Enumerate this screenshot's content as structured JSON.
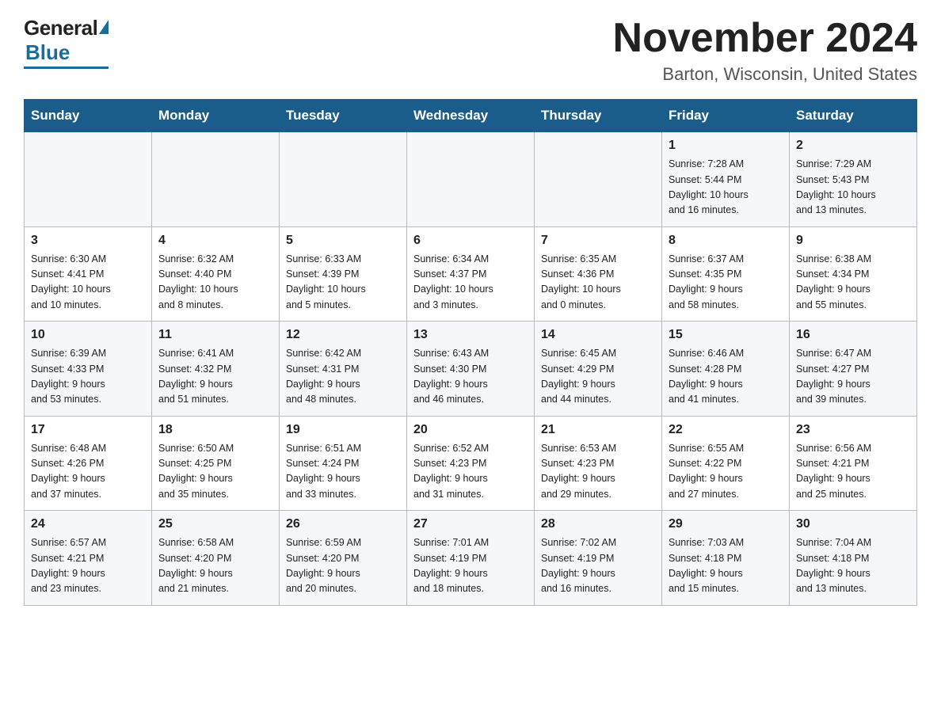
{
  "logo": {
    "general": "General",
    "blue": "Blue"
  },
  "title": "November 2024",
  "location": "Barton, Wisconsin, United States",
  "weekdays": [
    "Sunday",
    "Monday",
    "Tuesday",
    "Wednesday",
    "Thursday",
    "Friday",
    "Saturday"
  ],
  "weeks": [
    [
      {
        "day": "",
        "info": ""
      },
      {
        "day": "",
        "info": ""
      },
      {
        "day": "",
        "info": ""
      },
      {
        "day": "",
        "info": ""
      },
      {
        "day": "",
        "info": ""
      },
      {
        "day": "1",
        "info": "Sunrise: 7:28 AM\nSunset: 5:44 PM\nDaylight: 10 hours\nand 16 minutes."
      },
      {
        "day": "2",
        "info": "Sunrise: 7:29 AM\nSunset: 5:43 PM\nDaylight: 10 hours\nand 13 minutes."
      }
    ],
    [
      {
        "day": "3",
        "info": "Sunrise: 6:30 AM\nSunset: 4:41 PM\nDaylight: 10 hours\nand 10 minutes."
      },
      {
        "day": "4",
        "info": "Sunrise: 6:32 AM\nSunset: 4:40 PM\nDaylight: 10 hours\nand 8 minutes."
      },
      {
        "day": "5",
        "info": "Sunrise: 6:33 AM\nSunset: 4:39 PM\nDaylight: 10 hours\nand 5 minutes."
      },
      {
        "day": "6",
        "info": "Sunrise: 6:34 AM\nSunset: 4:37 PM\nDaylight: 10 hours\nand 3 minutes."
      },
      {
        "day": "7",
        "info": "Sunrise: 6:35 AM\nSunset: 4:36 PM\nDaylight: 10 hours\nand 0 minutes."
      },
      {
        "day": "8",
        "info": "Sunrise: 6:37 AM\nSunset: 4:35 PM\nDaylight: 9 hours\nand 58 minutes."
      },
      {
        "day": "9",
        "info": "Sunrise: 6:38 AM\nSunset: 4:34 PM\nDaylight: 9 hours\nand 55 minutes."
      }
    ],
    [
      {
        "day": "10",
        "info": "Sunrise: 6:39 AM\nSunset: 4:33 PM\nDaylight: 9 hours\nand 53 minutes."
      },
      {
        "day": "11",
        "info": "Sunrise: 6:41 AM\nSunset: 4:32 PM\nDaylight: 9 hours\nand 51 minutes."
      },
      {
        "day": "12",
        "info": "Sunrise: 6:42 AM\nSunset: 4:31 PM\nDaylight: 9 hours\nand 48 minutes."
      },
      {
        "day": "13",
        "info": "Sunrise: 6:43 AM\nSunset: 4:30 PM\nDaylight: 9 hours\nand 46 minutes."
      },
      {
        "day": "14",
        "info": "Sunrise: 6:45 AM\nSunset: 4:29 PM\nDaylight: 9 hours\nand 44 minutes."
      },
      {
        "day": "15",
        "info": "Sunrise: 6:46 AM\nSunset: 4:28 PM\nDaylight: 9 hours\nand 41 minutes."
      },
      {
        "day": "16",
        "info": "Sunrise: 6:47 AM\nSunset: 4:27 PM\nDaylight: 9 hours\nand 39 minutes."
      }
    ],
    [
      {
        "day": "17",
        "info": "Sunrise: 6:48 AM\nSunset: 4:26 PM\nDaylight: 9 hours\nand 37 minutes."
      },
      {
        "day": "18",
        "info": "Sunrise: 6:50 AM\nSunset: 4:25 PM\nDaylight: 9 hours\nand 35 minutes."
      },
      {
        "day": "19",
        "info": "Sunrise: 6:51 AM\nSunset: 4:24 PM\nDaylight: 9 hours\nand 33 minutes."
      },
      {
        "day": "20",
        "info": "Sunrise: 6:52 AM\nSunset: 4:23 PM\nDaylight: 9 hours\nand 31 minutes."
      },
      {
        "day": "21",
        "info": "Sunrise: 6:53 AM\nSunset: 4:23 PM\nDaylight: 9 hours\nand 29 minutes."
      },
      {
        "day": "22",
        "info": "Sunrise: 6:55 AM\nSunset: 4:22 PM\nDaylight: 9 hours\nand 27 minutes."
      },
      {
        "day": "23",
        "info": "Sunrise: 6:56 AM\nSunset: 4:21 PM\nDaylight: 9 hours\nand 25 minutes."
      }
    ],
    [
      {
        "day": "24",
        "info": "Sunrise: 6:57 AM\nSunset: 4:21 PM\nDaylight: 9 hours\nand 23 minutes."
      },
      {
        "day": "25",
        "info": "Sunrise: 6:58 AM\nSunset: 4:20 PM\nDaylight: 9 hours\nand 21 minutes."
      },
      {
        "day": "26",
        "info": "Sunrise: 6:59 AM\nSunset: 4:20 PM\nDaylight: 9 hours\nand 20 minutes."
      },
      {
        "day": "27",
        "info": "Sunrise: 7:01 AM\nSunset: 4:19 PM\nDaylight: 9 hours\nand 18 minutes."
      },
      {
        "day": "28",
        "info": "Sunrise: 7:02 AM\nSunset: 4:19 PM\nDaylight: 9 hours\nand 16 minutes."
      },
      {
        "day": "29",
        "info": "Sunrise: 7:03 AM\nSunset: 4:18 PM\nDaylight: 9 hours\nand 15 minutes."
      },
      {
        "day": "30",
        "info": "Sunrise: 7:04 AM\nSunset: 4:18 PM\nDaylight: 9 hours\nand 13 minutes."
      }
    ]
  ]
}
